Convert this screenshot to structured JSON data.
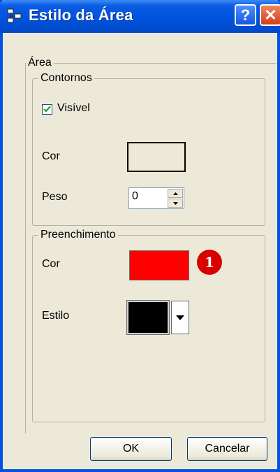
{
  "window": {
    "title": "Estilo da Área",
    "help_label": "?",
    "close_label": "✕"
  },
  "area_group": {
    "label": "Área"
  },
  "contornos": {
    "label": "Contornos",
    "visible_label": "Visível",
    "visible_checked": true,
    "color_label": "Cor",
    "weight_label": "Peso",
    "weight_value": "0"
  },
  "preenchimento": {
    "label": "Preenchimento",
    "color_label": "Cor",
    "fill_color": "#ff0000",
    "style_label": "Estilo",
    "style_color": "#000000",
    "badge": "1"
  },
  "buttons": {
    "ok": "OK",
    "cancel": "Cancelar"
  },
  "icons": [
    "app-icon",
    "help-icon",
    "close-icon",
    "checkmark-icon",
    "spin-up-icon",
    "spin-down-icon",
    "dropdown-arrow-icon"
  ]
}
